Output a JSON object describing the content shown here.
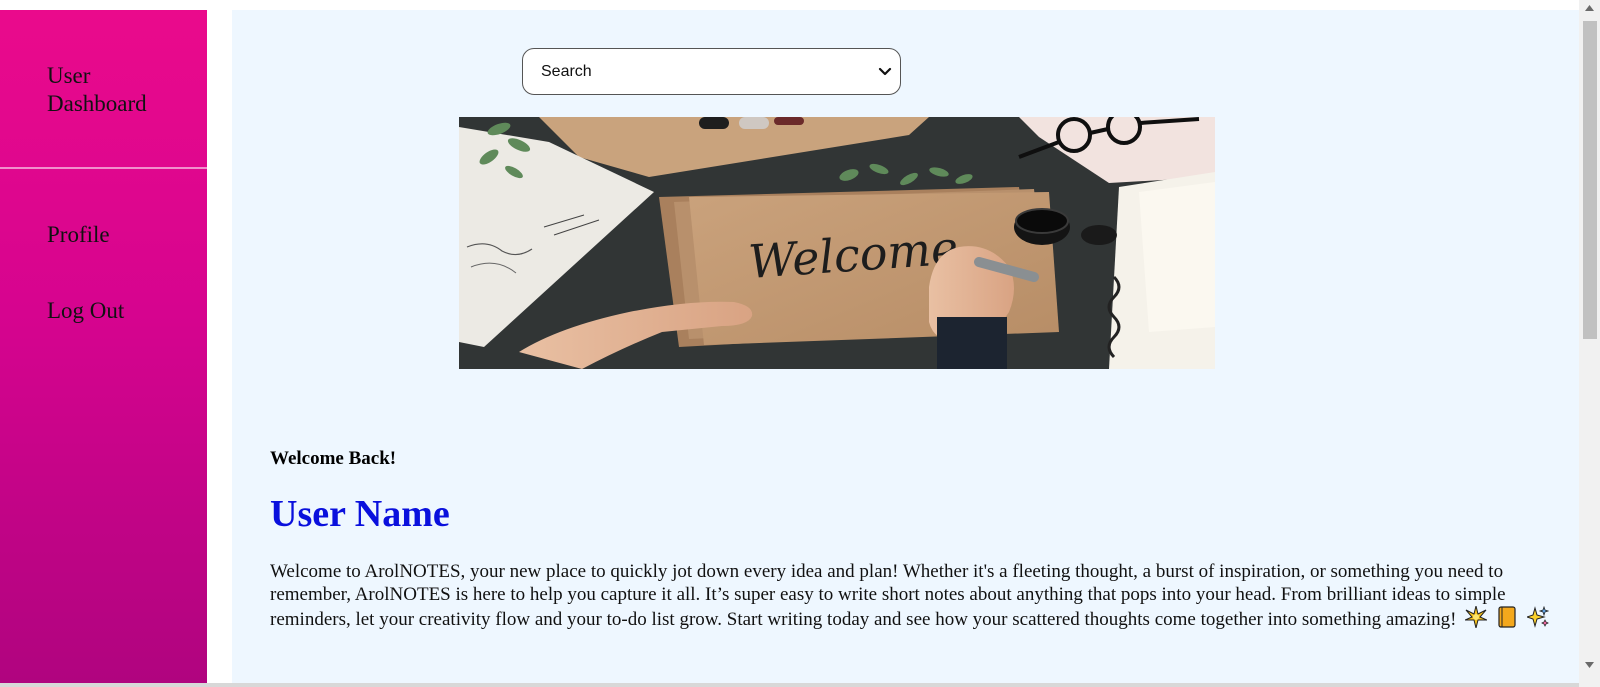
{
  "sidebar": {
    "items": [
      {
        "label": "User Dashboard",
        "icon": null
      },
      {
        "label": "Profile",
        "icon": null
      },
      {
        "label": "Log Out",
        "icon": null
      }
    ],
    "gradient_top": "#ea0a8c",
    "gradient_bottom": "#b0047f"
  },
  "search": {
    "selected": "Search",
    "icon": "chevron-down-icon"
  },
  "hero": {
    "script_text": "Welcome",
    "description_icon": "welcome-photo"
  },
  "main": {
    "greeting": "Welcome Back!",
    "user_name": "User Name",
    "intro": "Welcome to ArolNOTES, your new place to quickly jot down every idea and plan! Whether it's a fleeting thought, a burst of inspiration, or something you need to remember, ArolNOTES is here to help you capture it all. It’s super easy to write short notes about anything that pops into your head. From brilliant ideas to simple reminders, let your creativity flow and your to-do list grow. Start writing today and see how your scattered thoughts come together into something amazing!",
    "emojis": [
      "sparkle-burst-icon",
      "notebook-icon",
      "sparkles-icon"
    ]
  },
  "colors": {
    "main_bg": "#eef7ff",
    "user_name": "#0a10dd"
  }
}
